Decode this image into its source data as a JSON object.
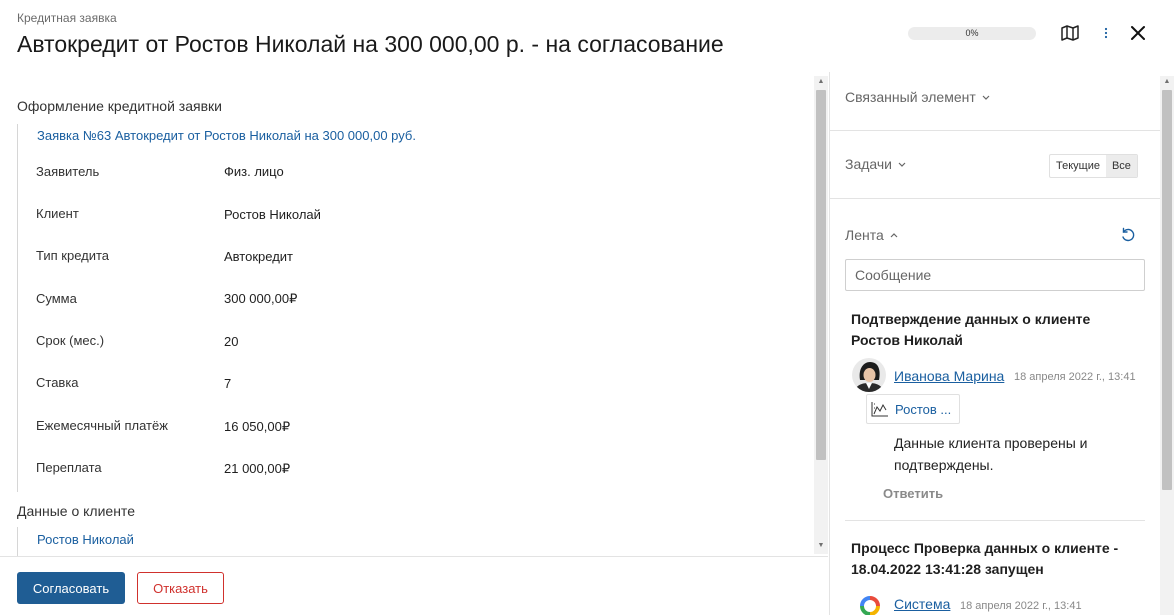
{
  "header": {
    "breadcrumb": "Кредитная заявка",
    "title": "Автокредит от Ростов Николай на 300 000,00 р. - на согласование",
    "progress_text": "0%",
    "progress_value": 0,
    "map_icon": "map-icon",
    "more_icon": "more-vertical-icon",
    "close_icon": "close-icon"
  },
  "main": {
    "section1_title": "Оформление кредитной заявки",
    "request_link": "Заявка №63 Автокредит от Ростов Николай на 300 000,00 руб.",
    "fields": [
      {
        "label": "Заявитель",
        "value": "Физ. лицо"
      },
      {
        "label": "Клиент",
        "value": "Ростов Николай"
      },
      {
        "label": "Тип кредита",
        "value": "Автокредит"
      },
      {
        "label": "Сумма",
        "value": "300 000,00₽"
      },
      {
        "label": "Срок (мес.)",
        "value": "20"
      },
      {
        "label": "Ставка",
        "value": "7"
      },
      {
        "label": "Ежемесячный платёж",
        "value": "16 050,00₽"
      },
      {
        "label": "Переплата",
        "value": "21 000,00₽"
      }
    ],
    "section2_title": "Данные о клиенте",
    "client_link": "Ростов Николай"
  },
  "footer": {
    "approve_label": "Согласовать",
    "reject_label": "Отказать"
  },
  "sidebar": {
    "linked_label": "Связанный элемент",
    "tasks_label": "Задачи",
    "tasks_filter": {
      "current": "Текущие",
      "all": "Все",
      "selected": "Все"
    },
    "feed_label": "Лента",
    "message_placeholder": "Сообщение",
    "feed": [
      {
        "title": "Подтверждение данных о клиенте Ростов Николай",
        "author": "Иванова Марина",
        "date": "18 апреля 2022 г., 13:41",
        "attachment": "Ростов ...",
        "text": "Данные клиента проверены и подтверждены.",
        "reply": "Ответить"
      },
      {
        "title": "Процесс Проверка данных о клиенте - 18.04.2022 13:41:28 запущен",
        "author": "Система",
        "date": "18 апреля 2022 г., 13:41"
      }
    ]
  },
  "colors": {
    "accent": "#1f5d94",
    "link": "#1a5fa0",
    "danger": "#d0312d"
  }
}
